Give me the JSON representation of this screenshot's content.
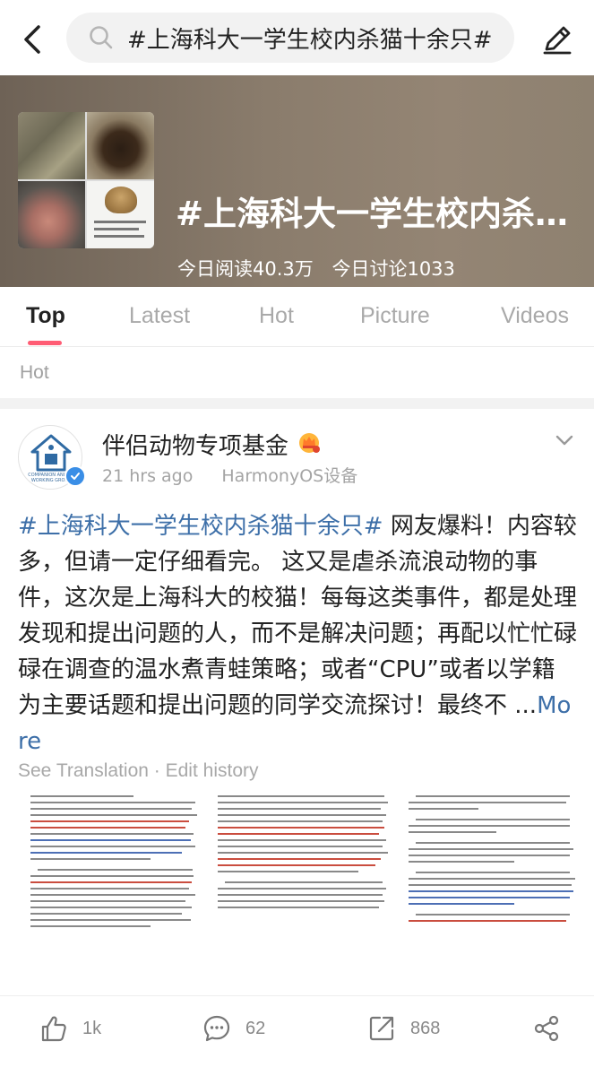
{
  "search": {
    "query": "#上海科大一学生校内杀猫十余只#"
  },
  "topic": {
    "title": "#上海科大一学生校内杀猫十余只#",
    "reads_today": "今日阅读40.3万",
    "discussions_today": "今日讨论1033"
  },
  "tabs": [
    {
      "label": "Top",
      "active": true
    },
    {
      "label": "Latest",
      "active": false
    },
    {
      "label": "Hot",
      "active": false
    },
    {
      "label": "Picture",
      "active": false
    },
    {
      "label": "Videos",
      "active": false
    }
  ],
  "section_label": "Hot",
  "post": {
    "author": "伴侣动物专项基金",
    "time": "21 hrs ago",
    "device": "HarmonyOS设备",
    "hashtag": "#上海科大一学生校内杀猫十余只#",
    "body": " 网友爆料！内容较多，但请一定仔细看完。 这又是虐杀流浪动物的事件，这次是上海科大的校猫！每每这类事件，都是处理发现和提出问题的人，而不是解决问题；再配以忙忙碌碌在调查的温水煮青蛙策略；或者“CPU”或者以学籍为主要话题和提出问题的同学交流探讨！最终不 ...",
    "more_label": "More",
    "see_translation": "See Translation",
    "separator": "·",
    "edit_history": "Edit history"
  },
  "actions": {
    "likes": "1k",
    "comments": "62",
    "reposts": "868"
  },
  "colors": {
    "accent_pink": "#ff5c74",
    "link_blue": "#3d6fa8",
    "verified_blue": "#3a8ee6"
  }
}
